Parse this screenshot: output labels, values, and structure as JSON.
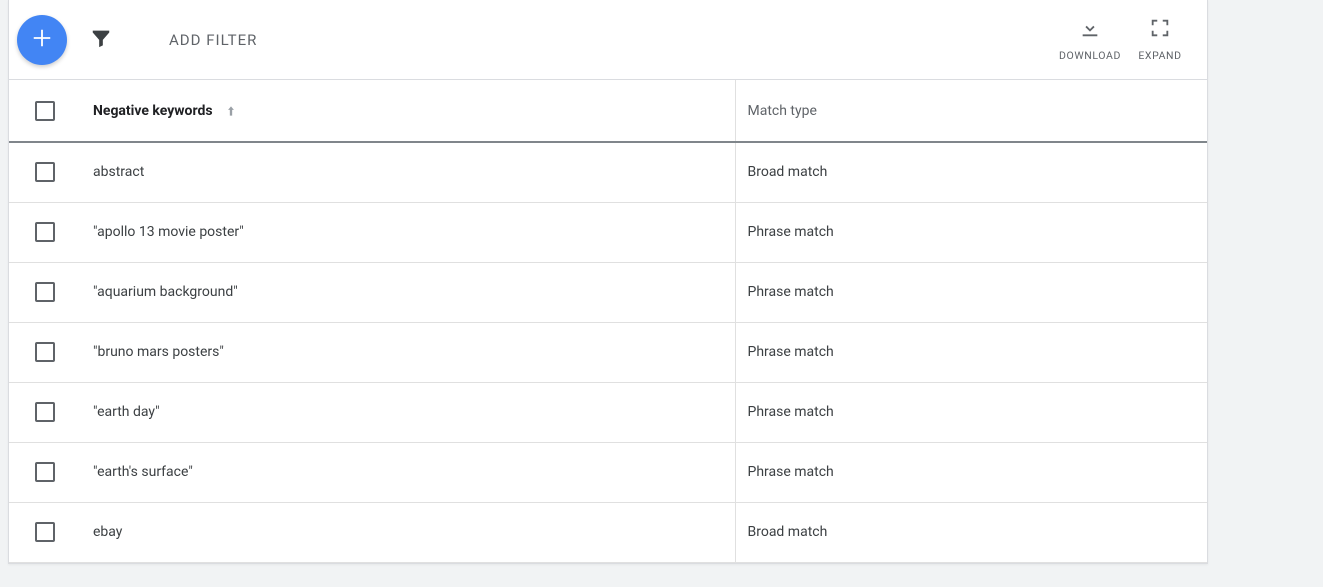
{
  "toolbar": {
    "add_filter_label": "ADD FILTER",
    "download_label": "DOWNLOAD",
    "expand_label": "EXPAND"
  },
  "table": {
    "columns": {
      "keyword": "Negative keywords",
      "match_type": "Match type"
    },
    "sort": {
      "column": "keyword",
      "direction": "asc"
    },
    "rows": [
      {
        "keyword": "abstract",
        "match_type": "Broad match"
      },
      {
        "keyword": "\"apollo 13 movie poster\"",
        "match_type": "Phrase match"
      },
      {
        "keyword": "\"aquarium background\"",
        "match_type": "Phrase match"
      },
      {
        "keyword": "\"bruno mars posters\"",
        "match_type": "Phrase match"
      },
      {
        "keyword": "\"earth day\"",
        "match_type": "Phrase match"
      },
      {
        "keyword": "\"earth's surface\"",
        "match_type": "Phrase match"
      },
      {
        "keyword": "ebay",
        "match_type": "Broad match"
      }
    ]
  }
}
